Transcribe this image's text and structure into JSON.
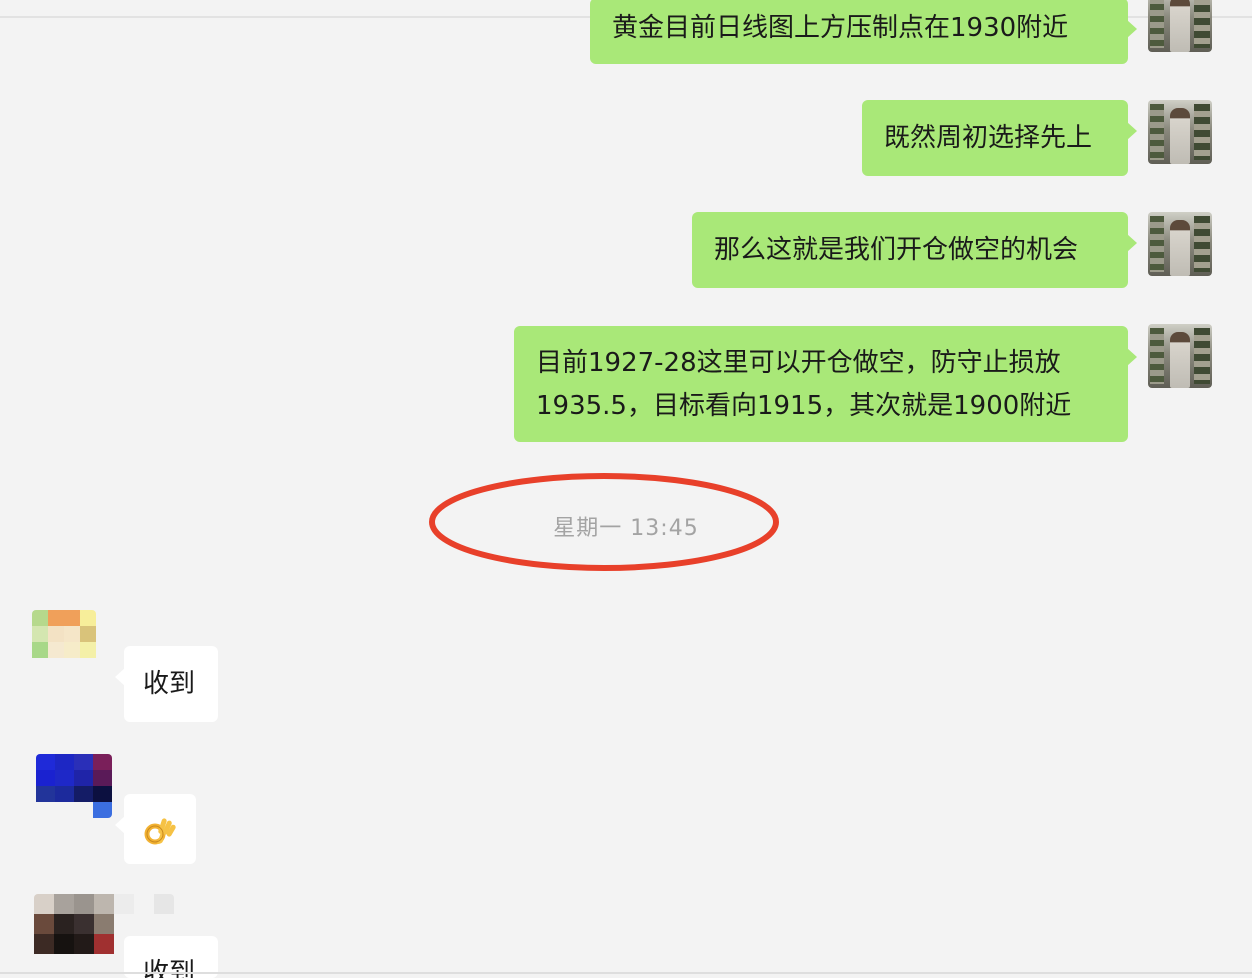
{
  "messages": [
    {
      "sender": "me",
      "text": "黄金目前日线图上方压制点在1930附近"
    },
    {
      "sender": "me",
      "text": "既然周初选择先上"
    },
    {
      "sender": "me",
      "text": "那么这就是我们开仓做空的机会"
    },
    {
      "sender": "me",
      "lines": [
        "目前1927-28这里可以开仓做空，防守止损放",
        "1935.5，目标看向1915，其次就是1900附近"
      ]
    },
    {
      "sender": "other-1",
      "text": "收到"
    },
    {
      "sender": "other-2",
      "emoji": "ok-hand"
    },
    {
      "sender": "other-3",
      "text": "收到"
    }
  ],
  "timestamp": "星期一 13:45",
  "colors": {
    "background": "#f3f3f3",
    "outgoing_bubble": "#a9e878",
    "incoming_bubble": "#ffffff",
    "timestamp_text": "#a3a3a3",
    "highlight_ring": "#e8402a"
  }
}
